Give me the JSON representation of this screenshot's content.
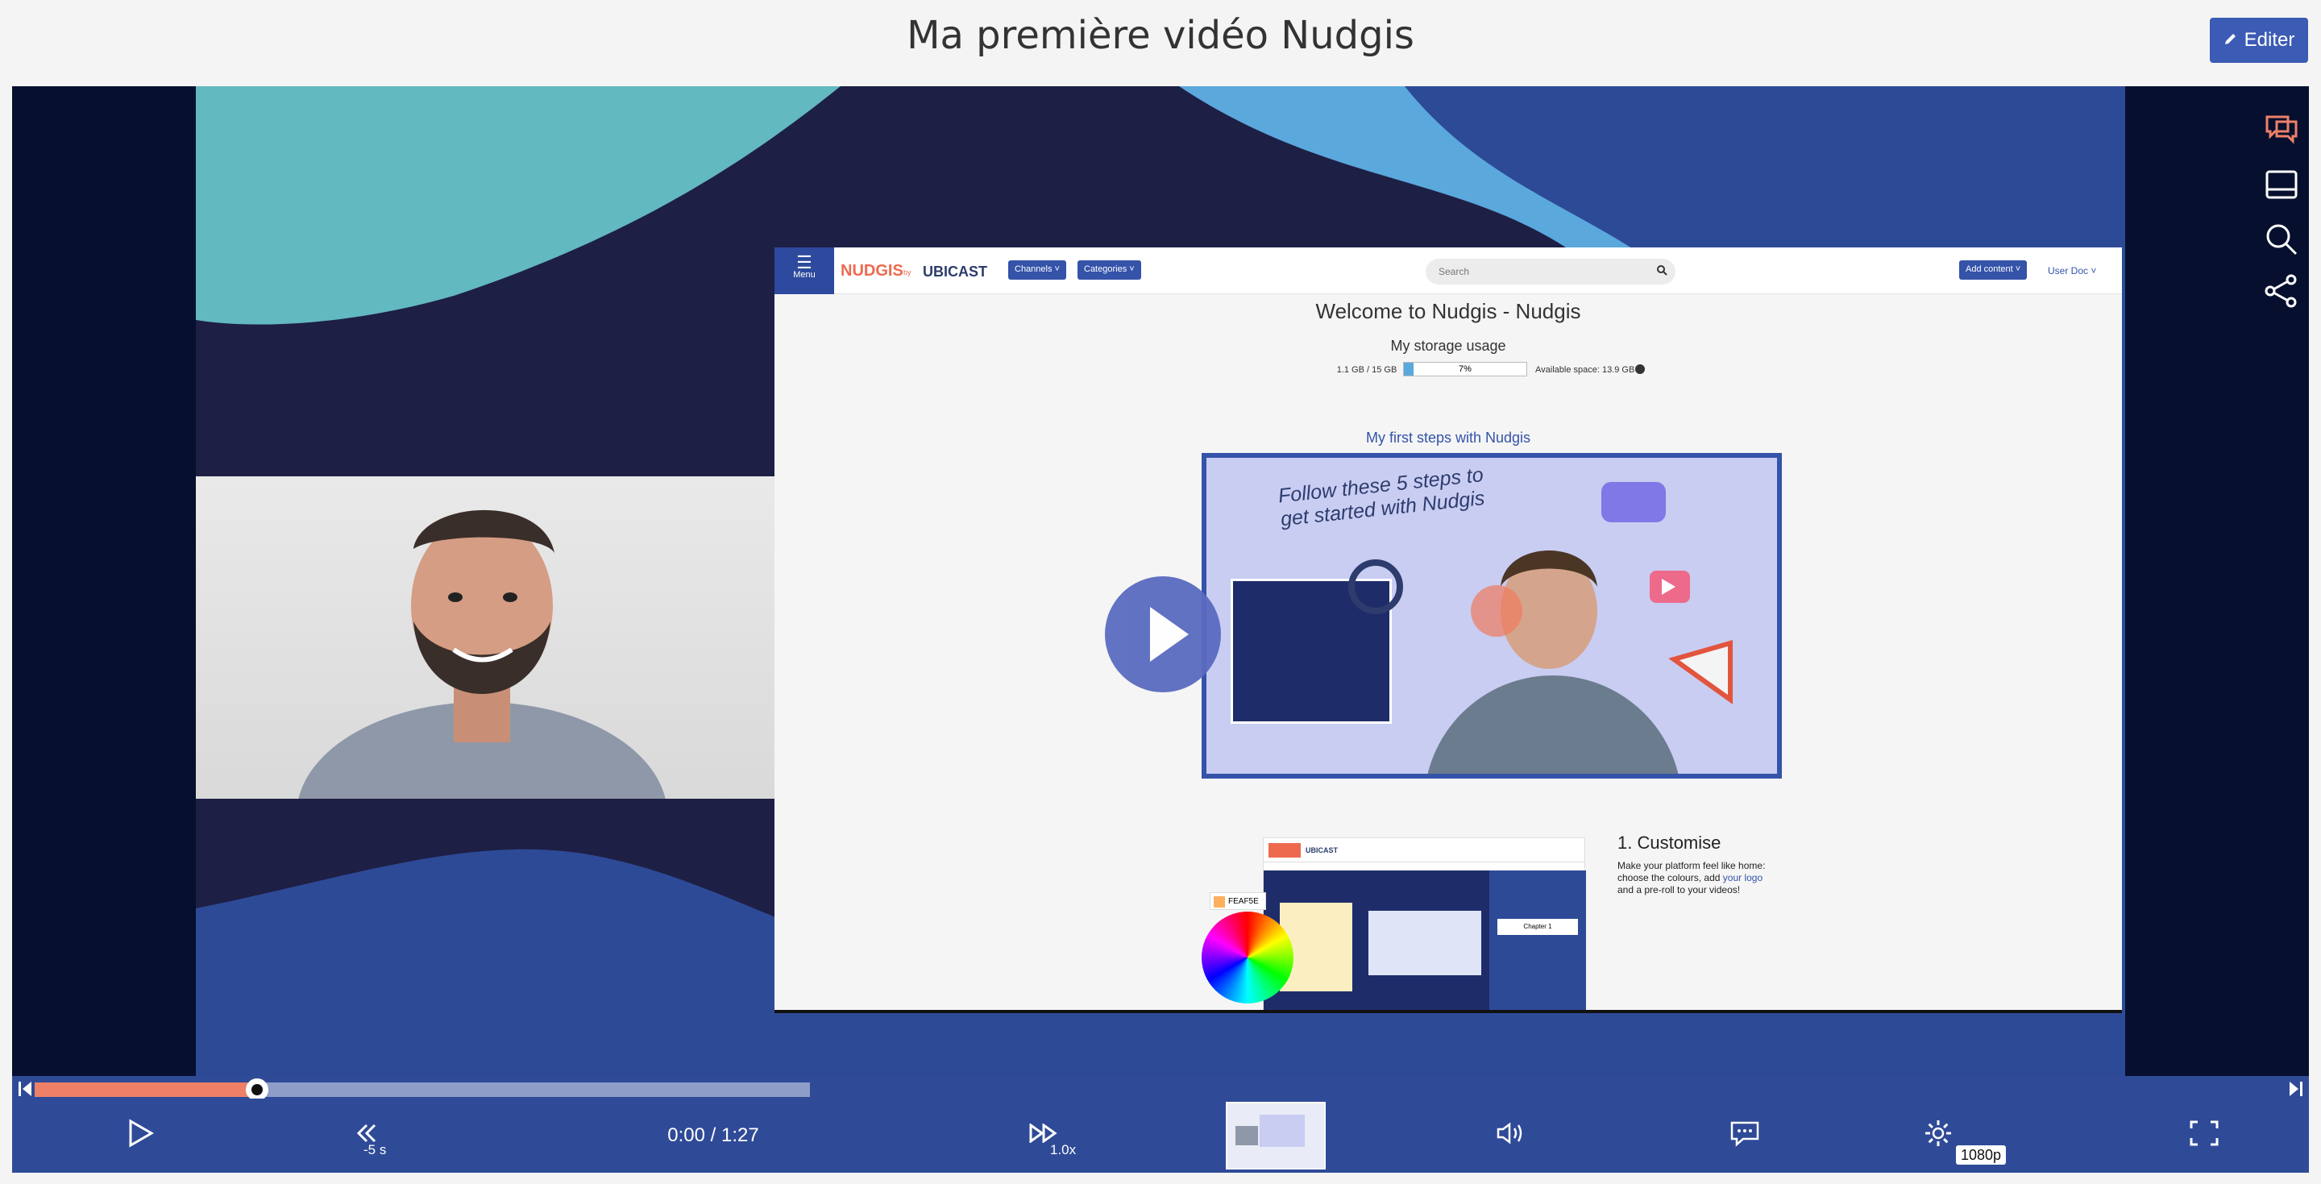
{
  "page": {
    "title": "Ma première vidéo Nudgis",
    "edit_label": "Editer"
  },
  "screen": {
    "menu_label": "Menu",
    "logo_text": "NUDGIS",
    "logo_by": "by",
    "brand": "UBICAST",
    "channels": "Channels ˅",
    "categories": "Categories ˅",
    "search_placeholder": "Search",
    "add_content": "Add content ˅",
    "user": "User Doc ˅",
    "welcome": "Welcome to Nudgis - Nudgis",
    "storage_title": "My storage usage",
    "storage_used": "1.1 GB / 15 GB",
    "storage_percent": "7%",
    "storage_fill": 0.07,
    "available_space": "Available space: 13.9 GB",
    "first_steps": "My first steps with Nudgis",
    "inner_caption": "Follow these 5 steps to get started with Nudgis",
    "customise_title": "1. Customise",
    "customise_text_1": "Make your platform feel like home:",
    "customise_text_2": "choose the colours, add",
    "customise_link": "your logo",
    "customise_text_3": "and a pre-roll to your videos!",
    "color_hex": "FEAF5E",
    "mini_brand": "UBICAST",
    "mini_chapter": "Chapter 1"
  },
  "player": {
    "time": "0:00 / 1:27",
    "rewind_label": "-5 s",
    "speed_label": "1.0x",
    "quality_label": "1080p",
    "progress_fraction": 0.1,
    "colors": {
      "accent": "#ee8068",
      "bar": "#2f4a97",
      "bg": "#06102e"
    }
  }
}
